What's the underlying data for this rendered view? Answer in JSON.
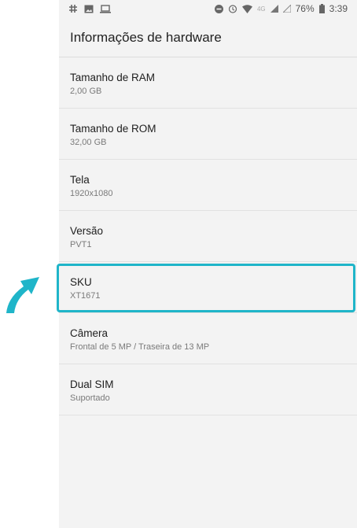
{
  "statusbar": {
    "network": "4G",
    "battery": "76%",
    "time": "3:39"
  },
  "header": {
    "title": "Informações de hardware"
  },
  "items": [
    {
      "title": "Tamanho de RAM",
      "value": "2,00 GB"
    },
    {
      "title": "Tamanho de ROM",
      "value": "32,00 GB"
    },
    {
      "title": "Tela",
      "value": "1920x1080"
    },
    {
      "title": "Versão",
      "value": "PVT1"
    },
    {
      "title": "SKU",
      "value": "XT1671"
    },
    {
      "title": "Câmera",
      "value": "Frontal de 5 MP / Traseira de 13 MP"
    },
    {
      "title": "Dual SIM",
      "value": "Suportado"
    }
  ],
  "annotation": {
    "highlighted_item": "SKU",
    "color": "#1fb5c9"
  }
}
